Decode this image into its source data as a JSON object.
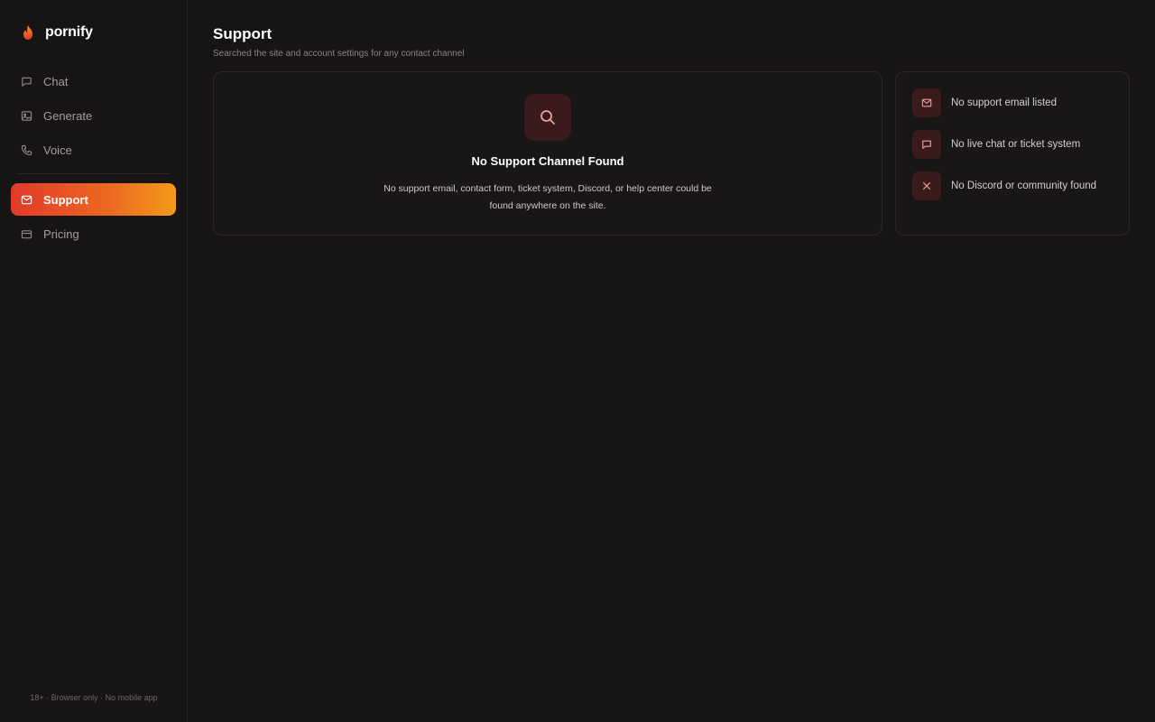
{
  "brand": {
    "name": "pornify",
    "accent": "#ee5a22"
  },
  "sidebar": {
    "items": [
      {
        "label": "Chat",
        "icon": "chat-bubble-icon"
      },
      {
        "label": "Generate",
        "icon": "image-icon"
      },
      {
        "label": "Voice",
        "icon": "phone-icon"
      },
      {
        "label": "Support",
        "icon": "mail-icon",
        "active": true
      },
      {
        "label": "Pricing",
        "icon": "credit-card-icon"
      }
    ],
    "footer": "18+ · Browser only · No mobile app"
  },
  "page": {
    "title": "Support",
    "subtitle": "Searched the site and account settings for any contact channel"
  },
  "empty_state": {
    "icon": "search-icon",
    "title": "No Support Channel Found",
    "description": "No support email, contact form, ticket system, Discord, or help center could be found anywhere on the site."
  },
  "status_list": [
    {
      "icon": "mail-icon",
      "text": "No support email listed"
    },
    {
      "icon": "chat-bubble-icon",
      "text": "No live chat or ticket system"
    },
    {
      "icon": "close-icon",
      "text": "No Discord or community found"
    }
  ],
  "colors": {
    "background": "#161415",
    "card_border": "#2b2728",
    "icon_badge": "#3a1a1b",
    "icon_tint": "#e9a3a0",
    "active_gradient_start": "#e2392a",
    "active_gradient_end": "#f39a1a"
  }
}
